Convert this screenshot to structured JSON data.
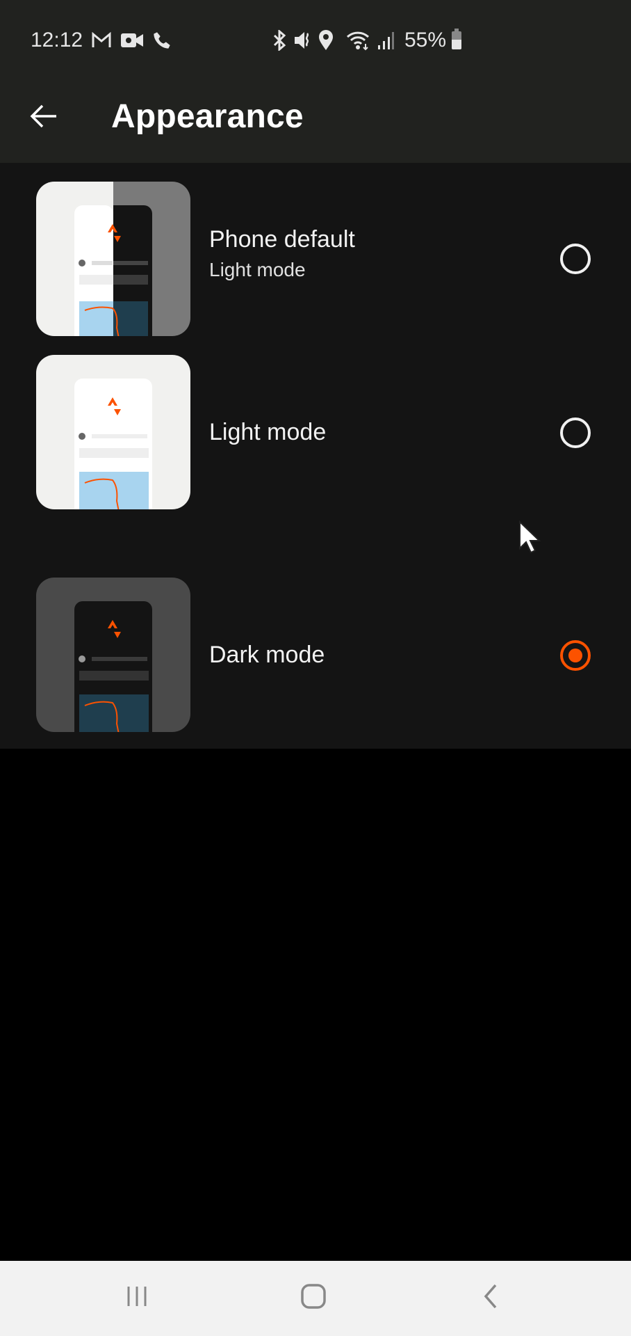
{
  "status_bar": {
    "time": "12:12",
    "left_icons": [
      "gmail-icon",
      "video-call-icon",
      "phone-call-icon"
    ],
    "right_icons": [
      "bluetooth-icon",
      "mute-icon",
      "location-icon",
      "wifi-icon",
      "signal-icon"
    ],
    "battery_percent": "55%",
    "battery_level": 0.55
  },
  "app_bar": {
    "back_icon": "arrow-left-icon",
    "title": "Appearance"
  },
  "options": [
    {
      "label": "Phone default",
      "sublabel": "Light mode",
      "selected": false,
      "preview": "split"
    },
    {
      "label": "Light mode",
      "sublabel": null,
      "selected": false,
      "preview": "light"
    },
    {
      "label": "Dark mode",
      "sublabel": null,
      "selected": true,
      "preview": "dark"
    }
  ],
  "colors": {
    "accent": "#fc5200",
    "background": "#141414",
    "header": "#21221f"
  },
  "nav_bar": {
    "recents": "recents-icon",
    "home": "home-icon",
    "back": "back-icon"
  }
}
